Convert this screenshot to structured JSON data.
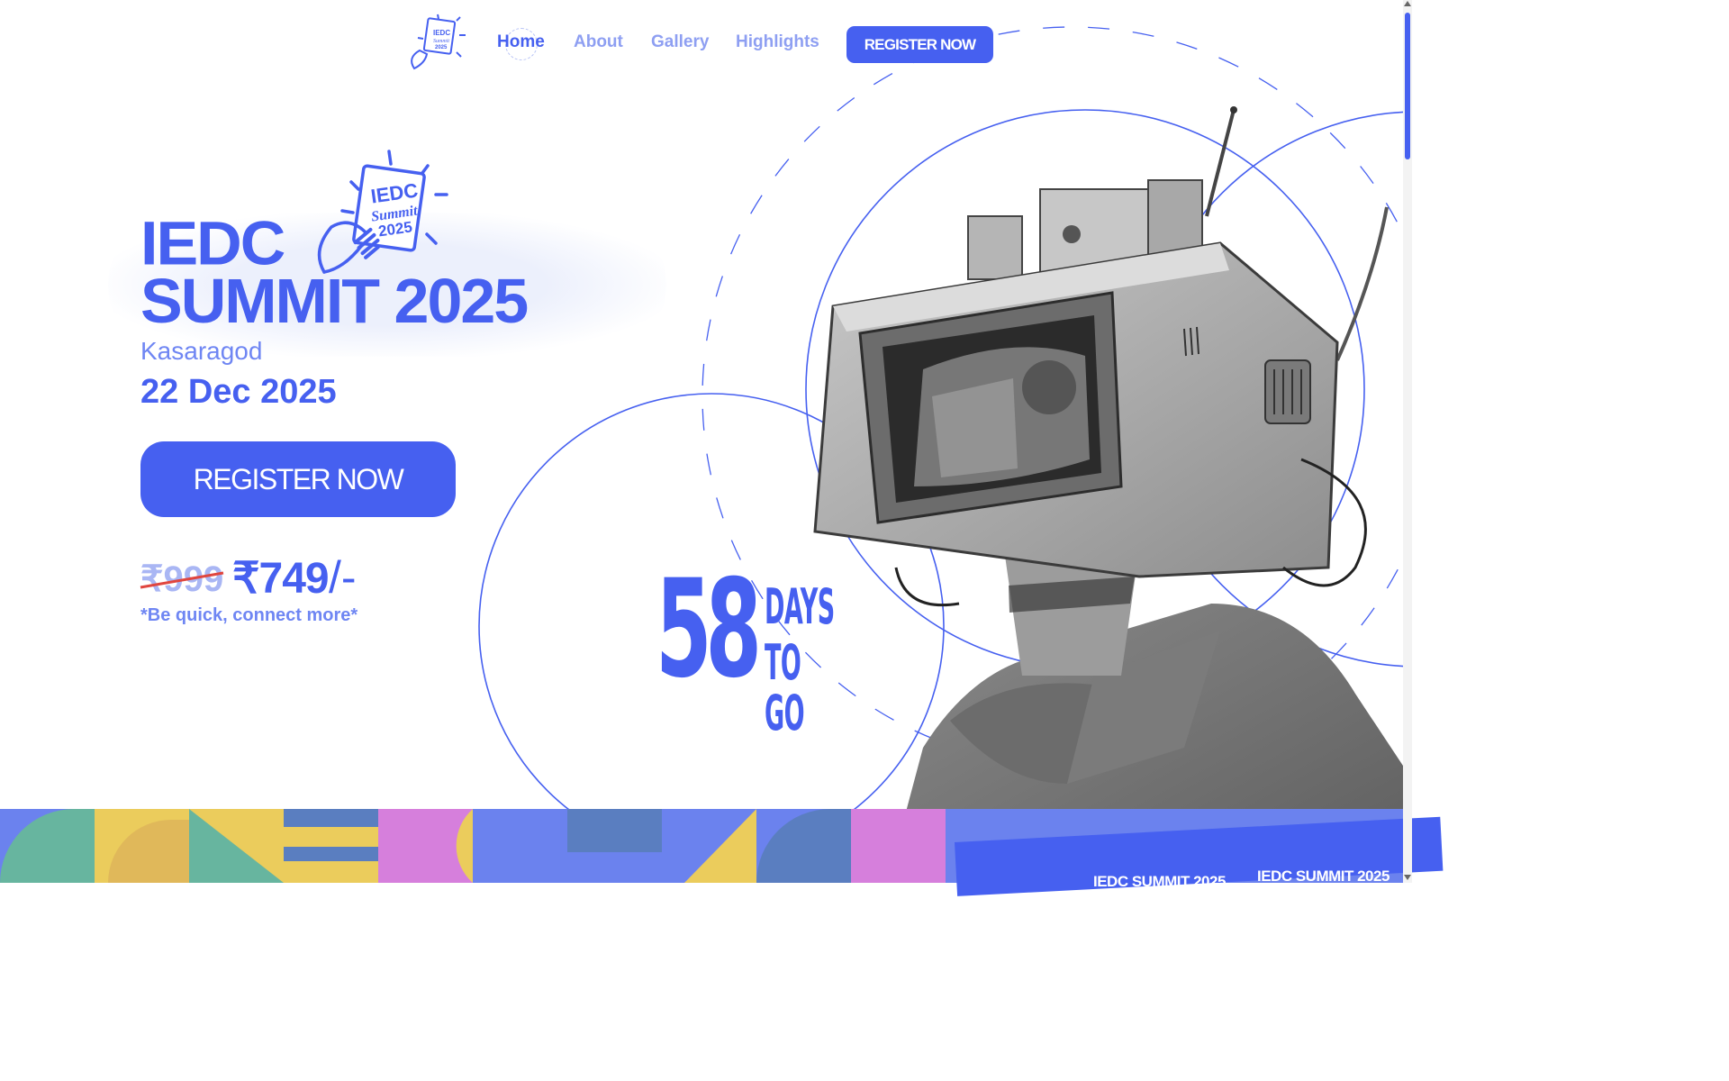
{
  "nav": {
    "logo_text": [
      "IEDC",
      "Summit",
      "2025"
    ],
    "links": [
      {
        "label": "Home",
        "active": true
      },
      {
        "label": "About",
        "active": false
      },
      {
        "label": "Gallery",
        "active": false
      },
      {
        "label": "Highlights",
        "active": false
      }
    ],
    "register_label": "REGISTER NOW"
  },
  "hero": {
    "title_line1": "IEDC",
    "title_line2": "SUMMIT 2025",
    "logo_text": [
      "IEDC",
      "Summit",
      "2025"
    ],
    "location": "Kasaragod",
    "date": "22 Dec 2025",
    "register_label": "REGISTER NOW",
    "price_old": "₹999",
    "price_new": "₹749",
    "price_suffix": "/-",
    "price_note": "*Be quick, connect more*"
  },
  "countdown": {
    "number": "58",
    "line1": "DAYS",
    "line2": "TO GO"
  },
  "ticker": {
    "items": [
      "IEDC SUMMIT 2025",
      "IEDC SUMMIT 2025",
      "IEDC SUMMIT 2025"
    ]
  },
  "colors": {
    "brand": "#4660f0",
    "brand_light": "#8e9ff2",
    "price_old": "#a9b6f4",
    "strike": "#e0463f",
    "strip": [
      "#6b82ee",
      "#ebcc5c",
      "#67b59f",
      "#d67fdc",
      "#5a7ec0"
    ]
  }
}
